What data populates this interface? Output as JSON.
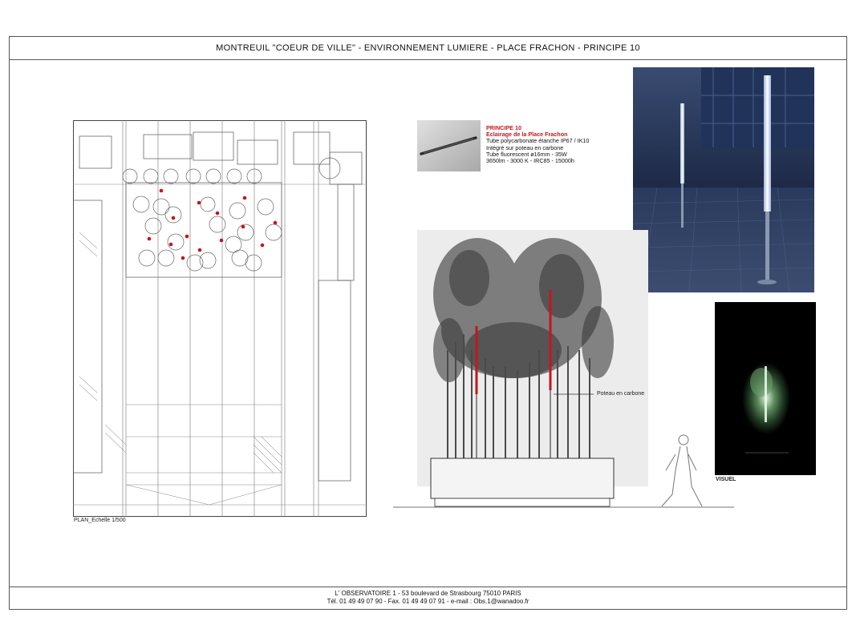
{
  "header": {
    "title": "MONTREUIL \"COEUR DE VILLE\" - ENVIRONNEMENT LUMIERE - PLACE FRACHON - PRINCIPE 10"
  },
  "plan": {
    "caption": "PLAN_Echelle 1/500"
  },
  "principle": {
    "heading": "PRINCIPE 10",
    "subheading": "Eclairage de la Place Frachon",
    "lines": [
      "Tube polycarbonate étanche IP67 / IK10",
      "Intégré sur poteau en carbone",
      "Tube fluorescent ø16mm - 35W",
      "3650lm - 3000 K - IRC85 - 15000h"
    ]
  },
  "elevation": {
    "annotation": "Poteau en carbone"
  },
  "visual": {
    "caption": "VISUEL"
  },
  "footer": {
    "line1": "L' OBSERVATOIRE 1 - 53 boulevard de Strasbourg 75010 PARIS",
    "line2": "Tél. 01 49 49 07 90 - Fax. 01 49 49 07 91 - e-mail : Obs.1@wanadoo.fr"
  },
  "colors": {
    "accent_red": "#c4161c",
    "night_blue": "#1e2d4a",
    "frame": "#555555"
  }
}
